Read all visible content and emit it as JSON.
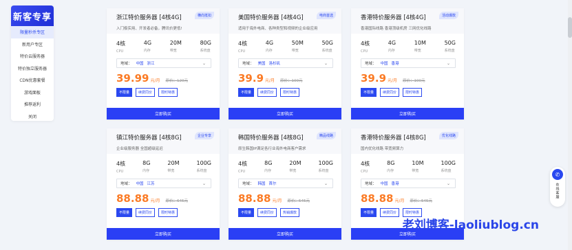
{
  "sidebar": {
    "header": "新客专享",
    "items": [
      "限量秒杀专区",
      "新用户专区",
      "特价云服务器",
      "特价独立服务器",
      "CDN优惠套餐",
      "游戏面板",
      "推荐返利",
      "关闭"
    ]
  },
  "spec_labels": [
    "CPU",
    "内存",
    "带宽",
    "系统盘"
  ],
  "region_prefix": "地域：",
  "buy_label": "立即购买",
  "price_unit": "元/月",
  "orig_prefix": "原价：",
  "cards": [
    {
      "title": "浙江特价服务器 [4核4G]",
      "badge": "横向抵扣",
      "desc": "入门极实用、开发者必备，腾讯价更低!",
      "specs": [
        "4核",
        "4G",
        "20M",
        "80G"
      ],
      "region": [
        "中国",
        "浙江"
      ],
      "price": "39.99",
      "orig": "原价：120元",
      "tags": [
        "不限量",
        "续费同价",
        "限时特惠"
      ]
    },
    {
      "title": "美国特价服务器 [4核4G]",
      "badge": "电商首选",
      "desc": "适用于海外电商、各种类型和视频的企业级应用",
      "specs": [
        "4核",
        "4G",
        "50M",
        "50G"
      ],
      "region": [
        "美国",
        "洛杉矶"
      ],
      "price": "39.9",
      "orig": "原价：100元",
      "tags": [
        "不限量",
        "续费同价",
        "限时特惠"
      ]
    },
    {
      "title": "香港特价服务器 [4核4G]",
      "badge": "活动爆款",
      "desc": "香港国际线路 香港顶级机房 三网优化线路",
      "specs": [
        "4核",
        "4G",
        "10M",
        "50G"
      ],
      "region": [
        "中国",
        "香港"
      ],
      "price": "39.9",
      "orig": "原价：100元",
      "tags": [
        "不限量",
        "续费同价",
        "限时特惠"
      ]
    },
    {
      "title": "镇江特价服务器 [4核8G]",
      "badge": "企业专享",
      "desc": "企业级服务器 全国超级延迟",
      "specs": [
        "4核",
        "8G",
        "20M",
        "100G"
      ],
      "region": [
        "中国",
        "江苏"
      ],
      "price": "88.88",
      "orig": "原价：645元",
      "tags": [
        "不限量",
        "续费同价",
        "限时特惠"
      ]
    },
    {
      "title": "韩国特价服务器 [4核8G]",
      "badge": "精品线路",
      "desc": "原生韩国IP满足各行业海外电商客户需求",
      "specs": [
        "4核",
        "8G",
        "20M",
        "100G"
      ],
      "region": [
        "韩国",
        "首尔"
      ],
      "price": "88.88",
      "orig": "原价：545元",
      "tags": [
        "不限量",
        "续费同价",
        "热销爆款"
      ]
    },
    {
      "title": "香港特价服务器 [4核8G]",
      "badge": "优化线路",
      "desc": "国内优化线路 带宽频算力",
      "specs": [
        "4核",
        "8G",
        "10M",
        "100G"
      ],
      "region": [
        "中国",
        "香港"
      ],
      "price": "88.88",
      "orig": "原价：545元",
      "tags": [
        "不限量",
        "续费同价",
        "限时特惠"
      ]
    }
  ],
  "online_service": "在线客服",
  "watermark": "老刘博客-laoliublog.cn"
}
